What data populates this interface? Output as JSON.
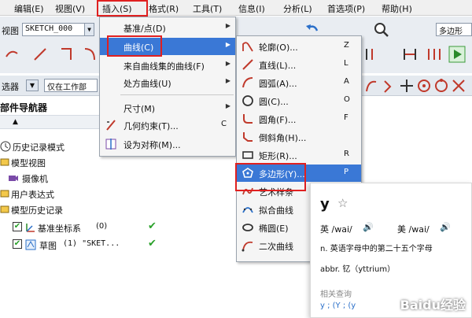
{
  "menubar": {
    "items": [
      {
        "label": "编辑(E)"
      },
      {
        "label": "视图(V)"
      },
      {
        "label": "插入(S)"
      },
      {
        "label": "格式(R)"
      },
      {
        "label": "工具(T)"
      },
      {
        "label": "信息(I)"
      },
      {
        "label": "分析(L)"
      },
      {
        "label": "首选项(P)"
      },
      {
        "label": "帮助(H)"
      }
    ]
  },
  "toolbar": {
    "view_label": "视图",
    "sketch_combo": "SKETCH_000",
    "right_combo": "多边形",
    "filter_label": "选器",
    "filter_combo": "仅在工作部"
  },
  "navigator": {
    "title": "部件导航器",
    "rows": [
      {
        "label": "历史记录模式"
      },
      {
        "label": "模型视图"
      },
      {
        "label": "摄像机"
      },
      {
        "label": "用户表达式"
      },
      {
        "label": "模型历史记录"
      },
      {
        "label": "基准坐标系",
        "extra": "(0)"
      },
      {
        "label": "草图",
        "extra": "(1) \"SKET..."
      }
    ]
  },
  "insert_menu": {
    "items": [
      {
        "label": "基准/点(D)"
      },
      {
        "label": "曲线(C)"
      },
      {
        "label": "来自曲线集的曲线(F)"
      },
      {
        "label": "处方曲线(U)"
      },
      {
        "label": "尺寸(M)"
      },
      {
        "label": "几何约束(T)...",
        "key": "C"
      },
      {
        "label": "设为对称(M)..."
      }
    ]
  },
  "curve_menu": {
    "items": [
      {
        "label": "轮廓(O)...",
        "key": "Z"
      },
      {
        "label": "直线(L)...",
        "key": "L"
      },
      {
        "label": "圆弧(A)...",
        "key": "A"
      },
      {
        "label": "圆(C)...",
        "key": "O"
      },
      {
        "label": "圆角(F)...",
        "key": "F"
      },
      {
        "label": "倒斜角(H)..."
      },
      {
        "label": "矩形(R)...",
        "key": "R"
      },
      {
        "label": "多边形(Y)...",
        "key": "P"
      },
      {
        "label": "艺术样条"
      },
      {
        "label": "拟合曲线"
      },
      {
        "label": "椭圆(E)"
      },
      {
        "label": "二次曲线"
      }
    ]
  },
  "dictionary": {
    "word": "y",
    "star": "☆",
    "uk_label": "英 /wai/",
    "us_label": "美 /wai/",
    "def_n": "n. 英语字母中的第二十五个字母",
    "def_abbr": "abbr. 钇（yttrium）",
    "related_label": "相关查询",
    "related_items": "y ; (Y ; (y"
  },
  "watermark": "Baidu经验",
  "colors": {
    "highlight": "#3a78d6",
    "callout": "#e02020",
    "check": "#2aa12a"
  }
}
